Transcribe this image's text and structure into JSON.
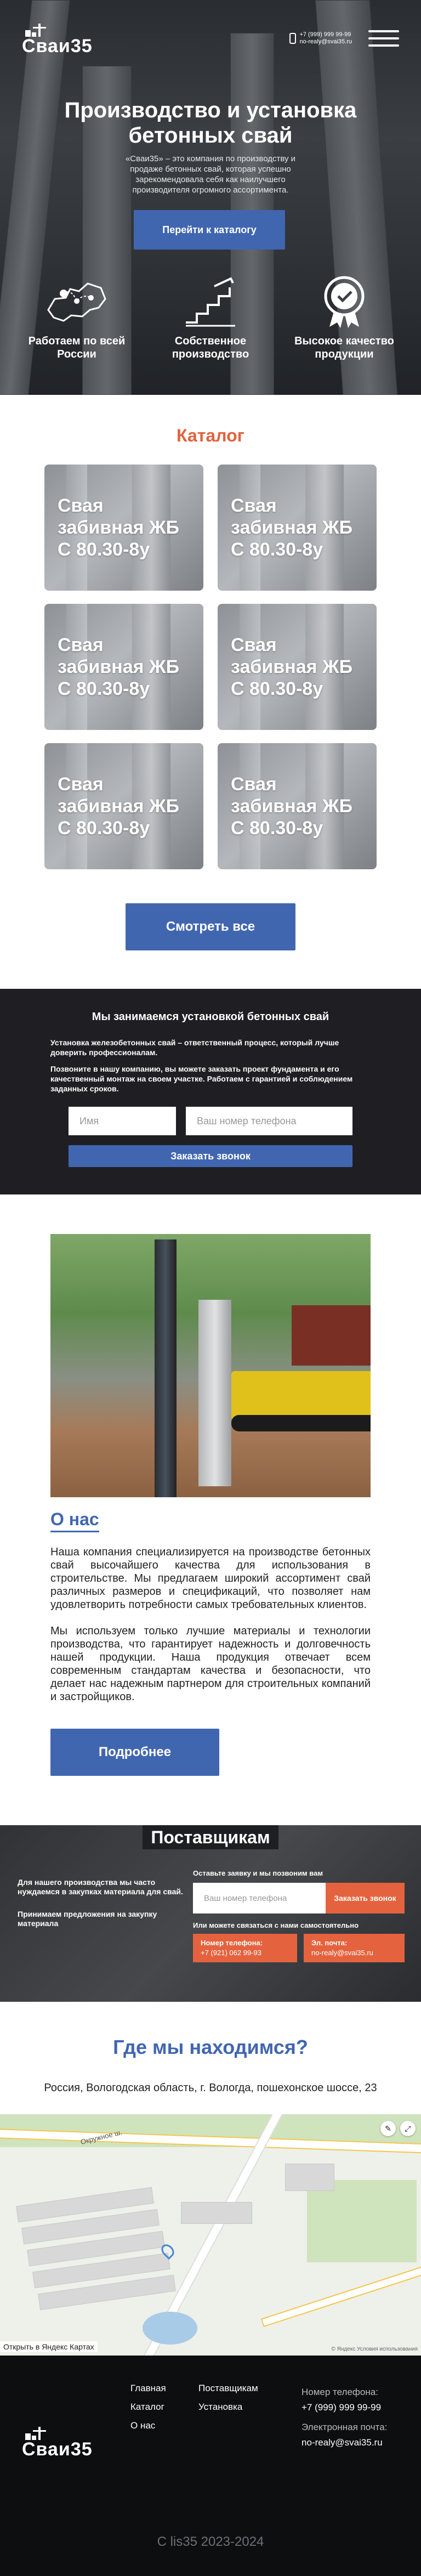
{
  "header": {
    "logo": "Сваи35",
    "phone": "+7 (999) 999 99-99",
    "email": "no-realy@svai35.ru"
  },
  "hero": {
    "title": "Производство и установка бетонных свай",
    "lead": "«Сваи35» – это компания по производству и продаже бетонных свай, которая успешно зарекомендовала себя как наилучшего производителя огромного ассортимента.",
    "cta": "Перейти к каталогу",
    "features": [
      {
        "icon": "russia-map-icon",
        "label": "Работаем по всей России"
      },
      {
        "icon": "production-stairs-icon",
        "label": "Собственное производство"
      },
      {
        "icon": "quality-badge-icon",
        "label": "Высокое качество продукции"
      }
    ]
  },
  "catalog": {
    "title": "Каталог",
    "items": [
      {
        "name": "Свая забивная ЖБ С 80.30-8у"
      },
      {
        "name": "Свая забивная ЖБ С 80.30-8у"
      },
      {
        "name": "Свая забивная ЖБ С 80.30-8у"
      },
      {
        "name": "Свая забивная ЖБ С 80.30-8у"
      },
      {
        "name": "Свая забивная ЖБ С 80.30-8у"
      },
      {
        "name": "Свая забивная ЖБ С 80.30-8у"
      }
    ],
    "more": "Смотреть все"
  },
  "install": {
    "title": "Мы занимаемся установкой бетонных свай",
    "p1": "Установка железобетонных свай – ответственный процесс, который лучше доверить профессионалам.",
    "p2": "Позвоните в нашу компанию, вы можете заказать проект фундамента и его качественный монтаж на своем участке. Работаем с гарантией и соблюдением заданных сроков.",
    "name_placeholder": "Имя",
    "phone_placeholder": "Ваш номер телефона",
    "submit": "Заказать звонок"
  },
  "about": {
    "title": "О нас",
    "p1": "Наша компания специализируется на производстве бетонных свай высочайшего качества для использования в строительстве. Мы предлагаем широкий ассортимент свай различных размеров и спецификаций, что позволяет нам удовлетворить потребности самых требовательных клиентов.",
    "p2": "Мы используем только лучшие материалы и технологии производства, что гарантирует надежность и долговечность нашей продукции. Наша продукция отвечает всем современным стандартам качества и безопасности, что делает нас надежным партнером для строительных компаний и застройщиков.",
    "more": "Подробнее"
  },
  "suppliers": {
    "title": "Поставщикам",
    "left1": "Для нашего производства мы часто нуждаемся в закупках материала для свай.",
    "left2": "Принимаем предложения на закупку материала",
    "form_label": "Оставьте заявку и мы позвоним вам",
    "phone_placeholder": "Ваш номер телефона",
    "submit": "Заказать звонок",
    "direct_label": "Или можете связаться с нами самостоятельно",
    "phone_title": "Номер телефона:",
    "phone": "+7 (921) 062 99-93",
    "email_title": "Эл. почта:",
    "email": "no-realy@svai35.ru"
  },
  "location": {
    "title": "Где мы находимся?",
    "address": "Россия, Вологодская область, г. Вологда, пошехонское шоссе, 23",
    "map_open": "Открыть в Яндекс Картах",
    "map_street": "Окружное ш.",
    "map_copy": "© Яндекс   Условия использования"
  },
  "footer": {
    "nav": [
      "Главная",
      "Поставщикам",
      "Каталог",
      "Установка",
      "О нас"
    ],
    "phone_label": "Номер телефона:",
    "phone": "+7 (999) 999 99-99",
    "email_label": "Электронная почта:",
    "email": "no-realy@svai35.ru",
    "copyright": "С lis35 2023-2024"
  },
  "colors": {
    "accent": "#4166b0",
    "orange": "#e0633e",
    "dark": "#1f1f23"
  }
}
